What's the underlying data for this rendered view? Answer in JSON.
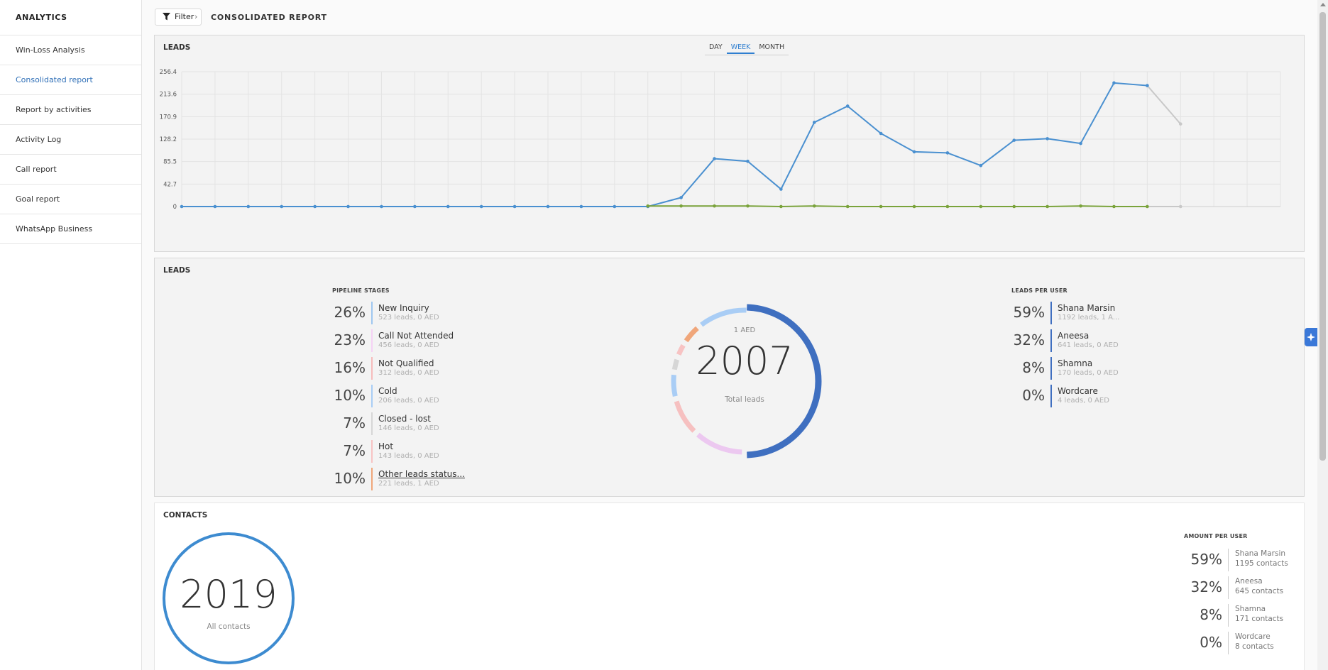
{
  "sidebar": {
    "title": "ANALYTICS",
    "items": [
      {
        "label": "Win-Loss Analysis"
      },
      {
        "label": "Consolidated report"
      },
      {
        "label": "Report by activities"
      },
      {
        "label": "Activity Log"
      },
      {
        "label": "Call report"
      },
      {
        "label": "Goal report"
      },
      {
        "label": "WhatsApp Business"
      }
    ]
  },
  "toolbar": {
    "filter_label": "Filter",
    "page_title": "CONSOLIDATED REPORT"
  },
  "leads_chart": {
    "title": "LEADS",
    "tabs": [
      "DAY",
      "WEEK",
      "MONTH"
    ],
    "active_tab": "WEEK"
  },
  "chart_data": {
    "type": "line",
    "title": "LEADS",
    "xlabel": "",
    "ylabel": "",
    "ylim": [
      0,
      256.4
    ],
    "y_ticks": [
      "0",
      "42.7",
      "85.5",
      "128.2",
      "170.9",
      "213.6",
      "256.4"
    ],
    "x": [
      1,
      2,
      3,
      4,
      5,
      6,
      7,
      8,
      9,
      10,
      11,
      12,
      13,
      14,
      15,
      16,
      17,
      18,
      19,
      20,
      21,
      22,
      23,
      24,
      25,
      26,
      27,
      28,
      29,
      30,
      31,
      32,
      33,
      34
    ],
    "series": [
      {
        "color": "#4a90d0",
        "values": [
          0,
          0,
          0,
          0,
          0,
          0,
          0,
          0,
          0,
          0,
          0,
          0,
          0,
          0,
          0,
          17,
          91,
          86,
          33,
          160,
          191,
          139,
          104,
          102,
          78,
          126,
          129,
          120,
          235,
          230,
          157
        ]
      },
      {
        "color": "#7aa33b",
        "values": [
          null,
          null,
          null,
          null,
          null,
          null,
          null,
          null,
          null,
          null,
          null,
          null,
          null,
          null,
          1,
          1,
          1,
          1,
          0,
          1,
          0,
          0,
          0,
          0,
          0,
          0,
          0,
          1,
          0,
          0,
          0
        ]
      }
    ],
    "grid": true
  },
  "pipeline": {
    "title": "LEADS",
    "stages_heading": "PIPELINE STAGES",
    "stages": [
      {
        "pct": "26%",
        "name": "New Inquiry",
        "sub": "523 leads, 0 AED",
        "color": "#9fc7f0"
      },
      {
        "pct": "23%",
        "name": "Call Not Attended",
        "sub": "456 leads, 0 AED",
        "color": "#f5d2f5"
      },
      {
        "pct": "16%",
        "name": "Not Qualified",
        "sub": "312 leads, 0 AED",
        "color": "#f6bcbc"
      },
      {
        "pct": "10%",
        "name": "Cold",
        "sub": "206 leads, 0 AED",
        "color": "#a9cdf5"
      },
      {
        "pct": "7%",
        "name": "Closed - lost",
        "sub": "146 leads, 0 AED",
        "color": "#d6d6d6"
      },
      {
        "pct": "7%",
        "name": "Hot",
        "sub": "143 leads, 0 AED",
        "color": "#f7c3c3"
      },
      {
        "pct": "10%",
        "name": "Other leads status...",
        "sub": "221 leads, 1 AED",
        "color": "#f0a67a"
      }
    ],
    "donut": {
      "amount": "1 AED",
      "total": "2007",
      "label": "Total leads",
      "outer_color": "#3f6fc0",
      "outer_fraction": 0.5,
      "inner_segments": [
        {
          "color": "#ecc8f0",
          "fraction": 0.12
        },
        {
          "color": "#f6c0c0",
          "fraction": 0.09
        },
        {
          "color": "#a9cdf5",
          "fraction": 0.06
        },
        {
          "color": "#d6d6d6",
          "fraction": 0.035
        },
        {
          "color": "#f7c3c3",
          "fraction": 0.035
        },
        {
          "color": "#f0a67a",
          "fraction": 0.05
        },
        {
          "color": "#a9cdf5",
          "fraction": 0.12
        }
      ]
    },
    "users_heading": "LEADS PER USER",
    "users": [
      {
        "pct": "59%",
        "name": "Shana Marsin",
        "sub": "1192 leads, 1 A...",
        "color": "#3f6fc0"
      },
      {
        "pct": "32%",
        "name": "Aneesa",
        "sub": "641 leads, 0 AED",
        "color": "#3f6fc0"
      },
      {
        "pct": "8%",
        "name": "Shamna",
        "sub": "170 leads, 0 AED",
        "color": "#3f6fc0"
      },
      {
        "pct": "0%",
        "name": "Wordcare",
        "sub": "4 leads, 0 AED",
        "color": "#3f6fc0"
      }
    ]
  },
  "contacts": {
    "title": "CONTACTS",
    "total": "2019",
    "label": "All contacts",
    "ring_color": "#3d8bd0",
    "users_heading": "AMOUNT PER USER",
    "users": [
      {
        "pct": "59%",
        "name": "Shana Marsin",
        "sub": "1195 contacts"
      },
      {
        "pct": "32%",
        "name": "Aneesa",
        "sub": "645 contacts"
      },
      {
        "pct": "8%",
        "name": "Shamna",
        "sub": "171 contacts"
      },
      {
        "pct": "0%",
        "name": "Wordcare",
        "sub": "8 contacts"
      }
    ]
  }
}
